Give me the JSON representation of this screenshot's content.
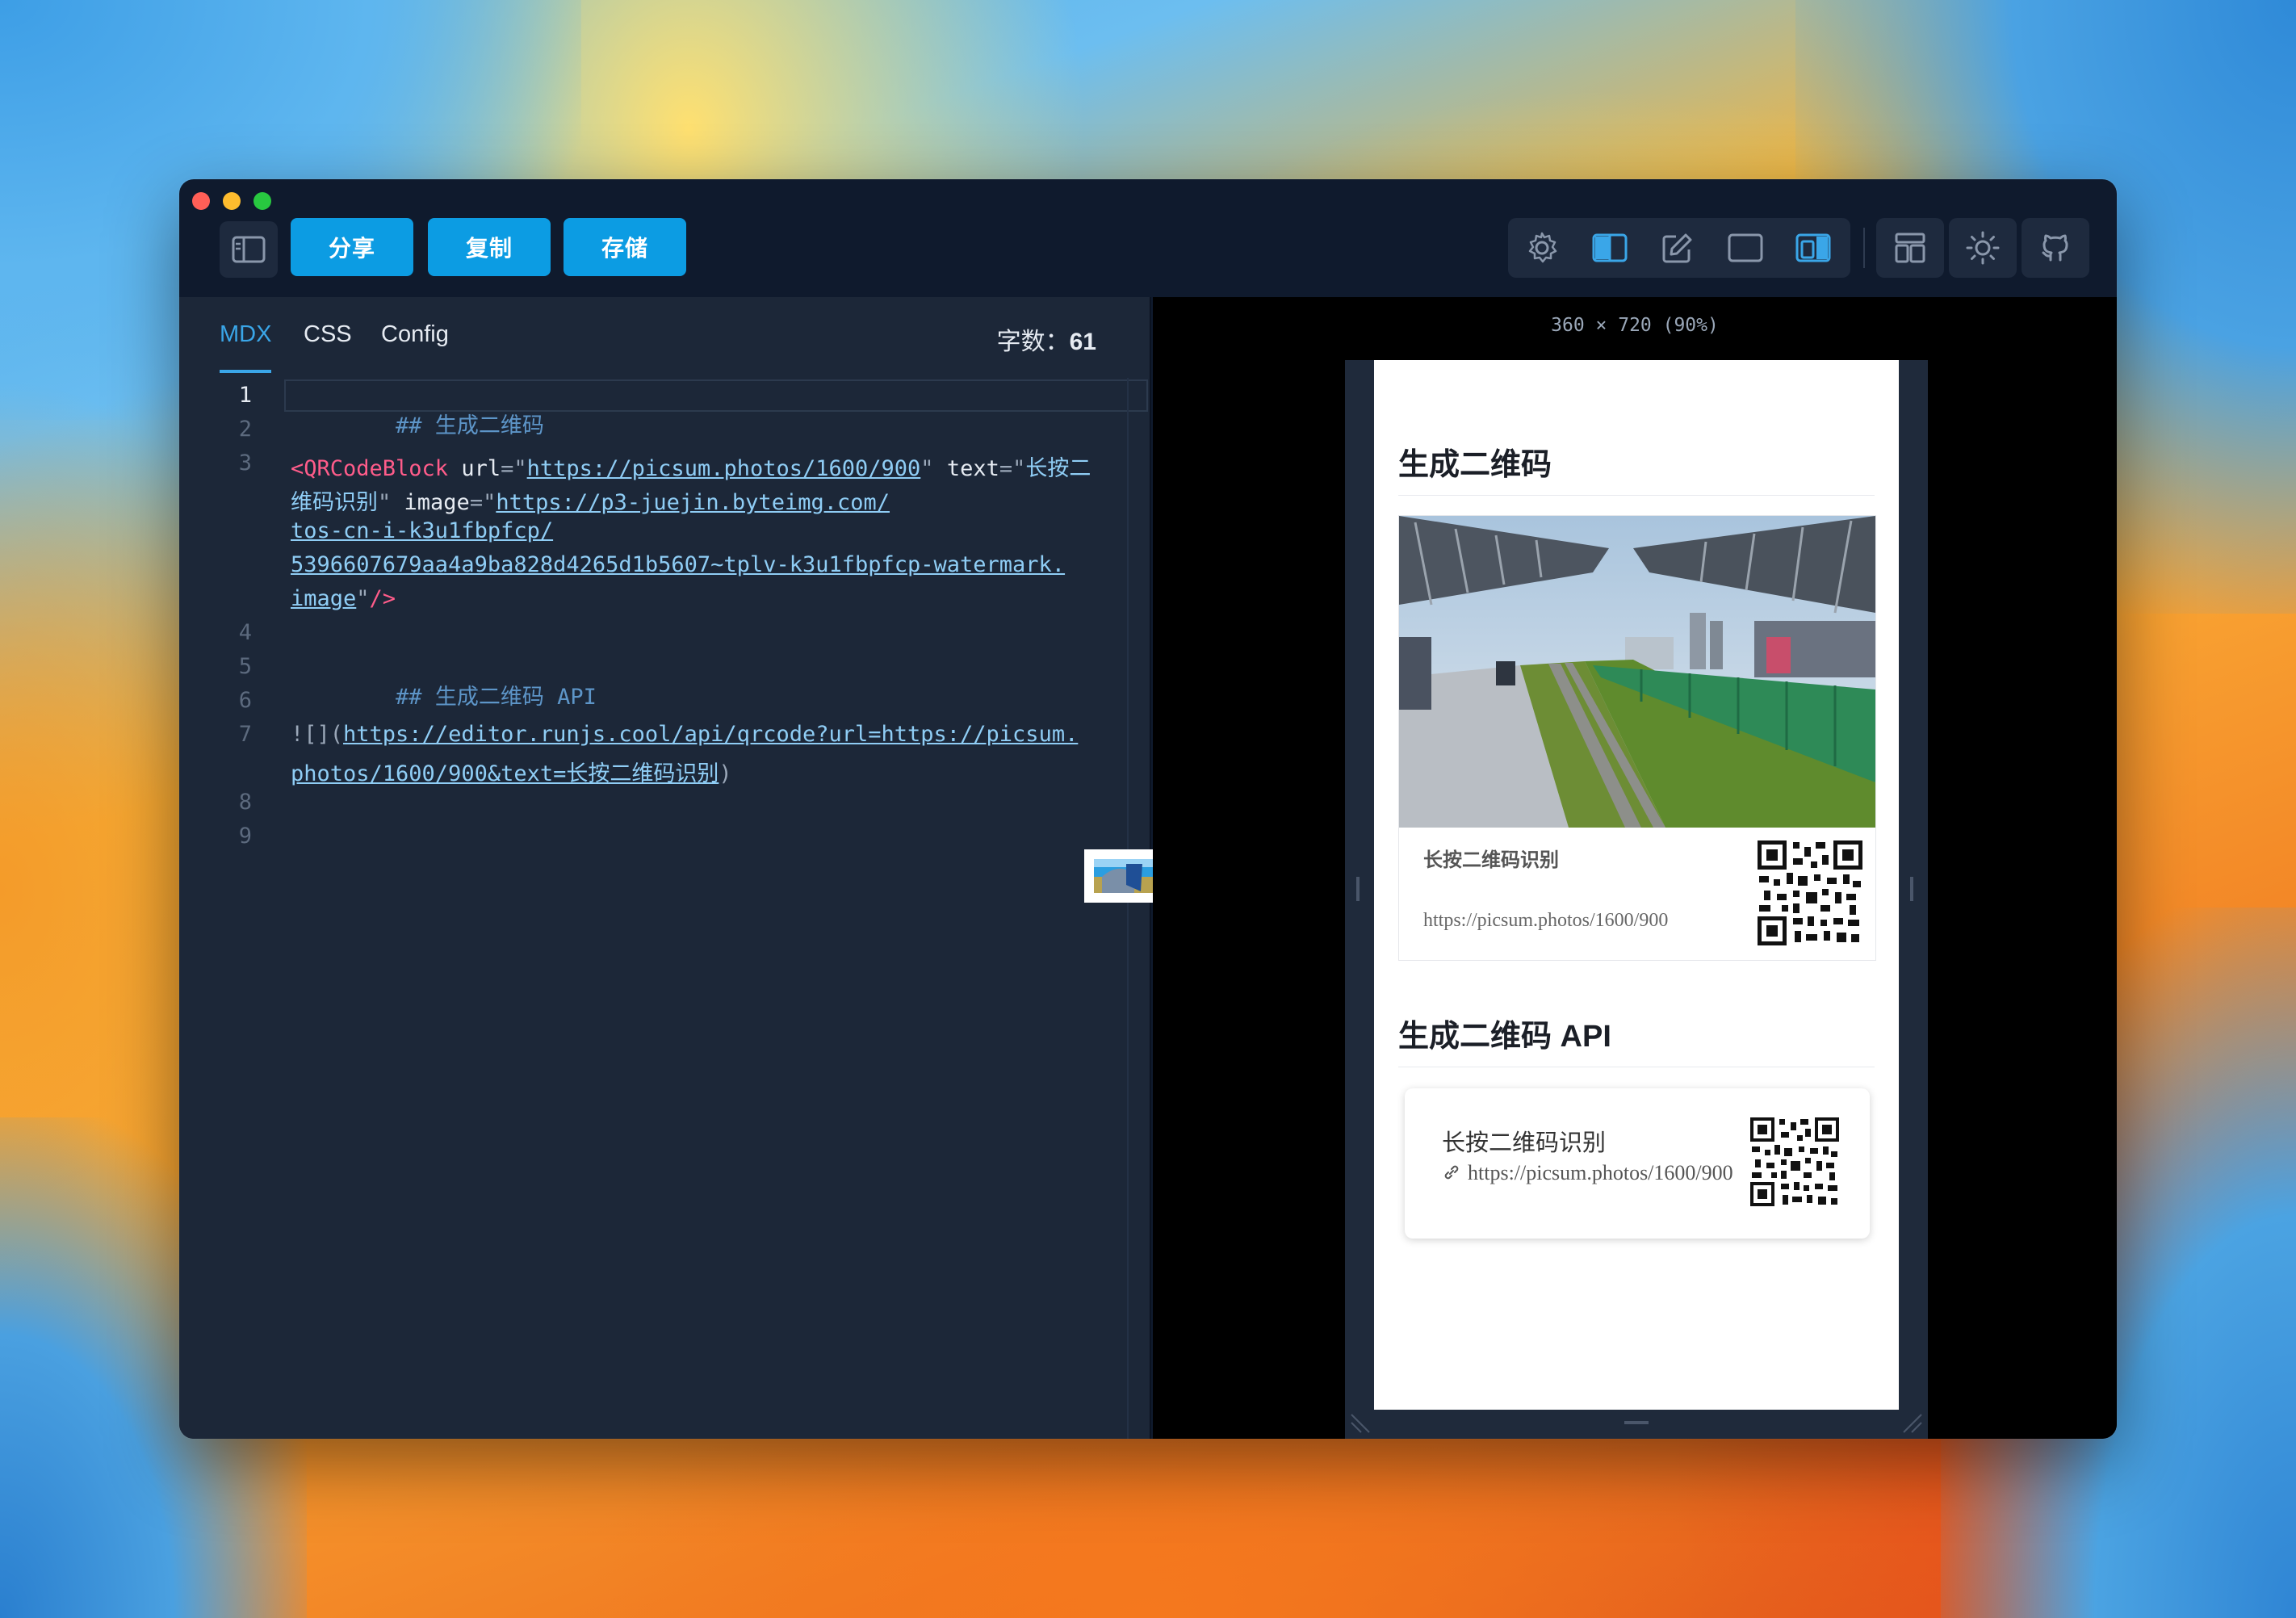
{
  "toolbar": {
    "share_label": "分享",
    "copy_label": "复制",
    "save_label": "存储"
  },
  "editor": {
    "tabs": [
      {
        "label": "MDX",
        "active": true
      },
      {
        "label": "CSS",
        "active": false
      },
      {
        "label": "Config",
        "active": false
      }
    ],
    "wordcount_label": "字数：",
    "wordcount_value": "61",
    "gutter": [
      "1",
      "2",
      "3",
      "4",
      "5",
      "6",
      "7",
      "8",
      "9"
    ],
    "lines": {
      "l1": "## 生成二维码",
      "l3_tag": "<QRCodeBlock",
      "l3_url_attr": " url",
      "l3_eq1": "=\"",
      "l3_url": "https://picsum.photos/1600/900",
      "l3_q1": "\"",
      "l3_text_attr": " text",
      "l3_eq2": "=\"",
      "l3_text_a": "长按二",
      "l3b_text_b": "维码识别",
      "l3b_q": "\"",
      "l3b_image_attr": " image",
      "l3b_eq": "=\"",
      "l3b_url": "https://p3-juejin.byteimg.com/",
      "l3c_url": "tos-cn-i-k3u1fbpfcp/",
      "l3d_url": "5396607679aa4a9ba828d4265d1b5607~tplv-k3u1fbpfcp-watermark.",
      "l3e_url": "image",
      "l3e_q": "\"",
      "l3e_close": "/>",
      "l5": "## 生成二维码 API",
      "l7_prefix": "![](",
      "l7_url": "https://editor.runjs.cool/api/qrcode?url=https://picsum.",
      "l7b_url": "photos/1600/900&text=长按二维码识别",
      "l7b_suffix": ")"
    }
  },
  "preview": {
    "dimensions": "360 × 720 (90%)",
    "heading1": "生成二维码",
    "qr_caption": "长按二维码识别",
    "qr_url": "https://picsum.photos/1600/900",
    "heading2": "生成二维码 API",
    "api_title": "长按二维码识别",
    "api_url": "https://picsum.photos/1600/900"
  },
  "colors": {
    "accent": "#0c9ce3",
    "window_bg": "#0f1a2d",
    "editor_bg": "#1c2738"
  }
}
